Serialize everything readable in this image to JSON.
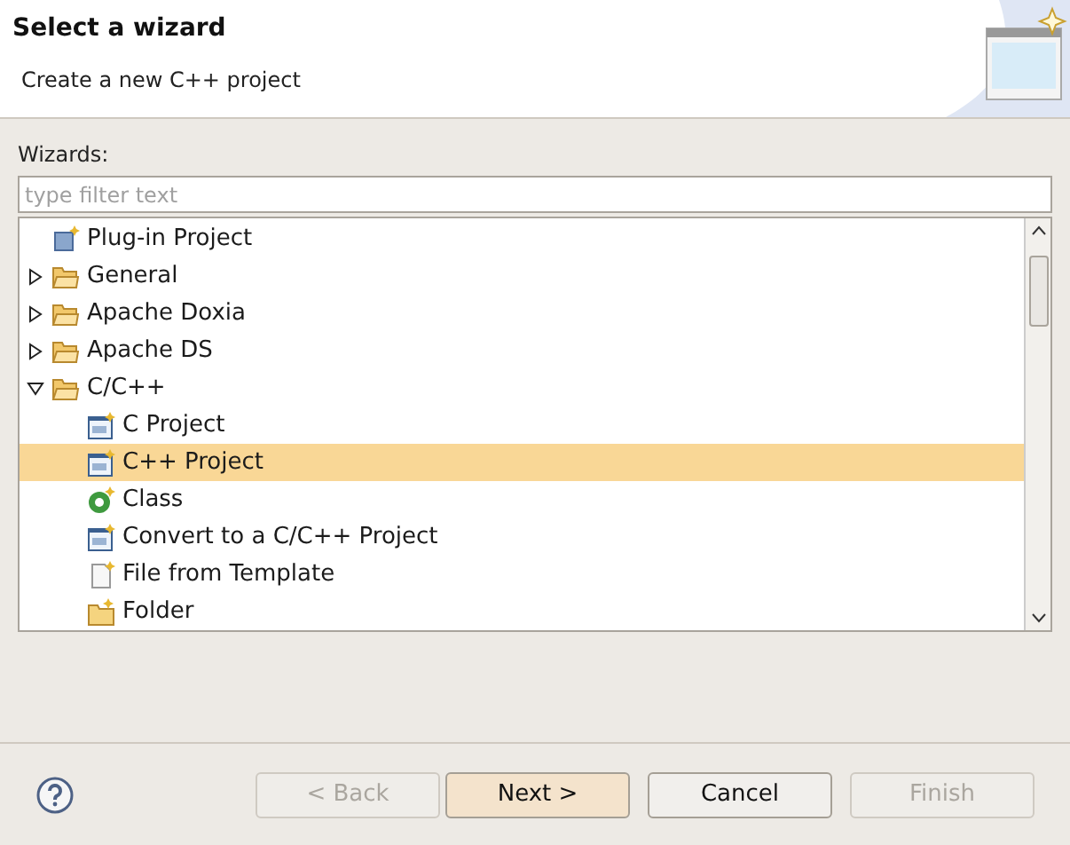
{
  "header": {
    "title": "Select a wizard",
    "subtitle": "Create a new C++ project"
  },
  "filter": {
    "label": "Wizards:",
    "placeholder": "type filter text"
  },
  "tree": [
    {
      "label": "Plug-in Project",
      "kind": "plugin",
      "selected": false
    },
    {
      "label": "General",
      "kind": "folder",
      "expanded": false,
      "selected": false
    },
    {
      "label": "Apache Doxia",
      "kind": "folder",
      "expanded": false,
      "selected": false
    },
    {
      "label": "Apache DS",
      "kind": "folder",
      "expanded": false,
      "selected": false
    },
    {
      "label": "C/C++",
      "kind": "folder",
      "expanded": true,
      "selected": false,
      "children": [
        {
          "label": "C Project",
          "kind": "project",
          "selected": false
        },
        {
          "label": "C++ Project",
          "kind": "project",
          "selected": true
        },
        {
          "label": "Class",
          "kind": "class",
          "selected": false
        },
        {
          "label": "Convert to a C/C++ Project",
          "kind": "project",
          "selected": false
        },
        {
          "label": "File from Template",
          "kind": "file",
          "selected": false
        },
        {
          "label": "Folder",
          "kind": "newfolder",
          "selected": false
        }
      ]
    }
  ],
  "buttons": [
    {
      "label": "< Back",
      "disabled": true,
      "default": false
    },
    {
      "label": "Next >",
      "disabled": false,
      "default": true
    },
    {
      "label": "Cancel",
      "disabled": false,
      "default": false
    },
    {
      "label": "Finish",
      "disabled": true,
      "default": false
    }
  ]
}
